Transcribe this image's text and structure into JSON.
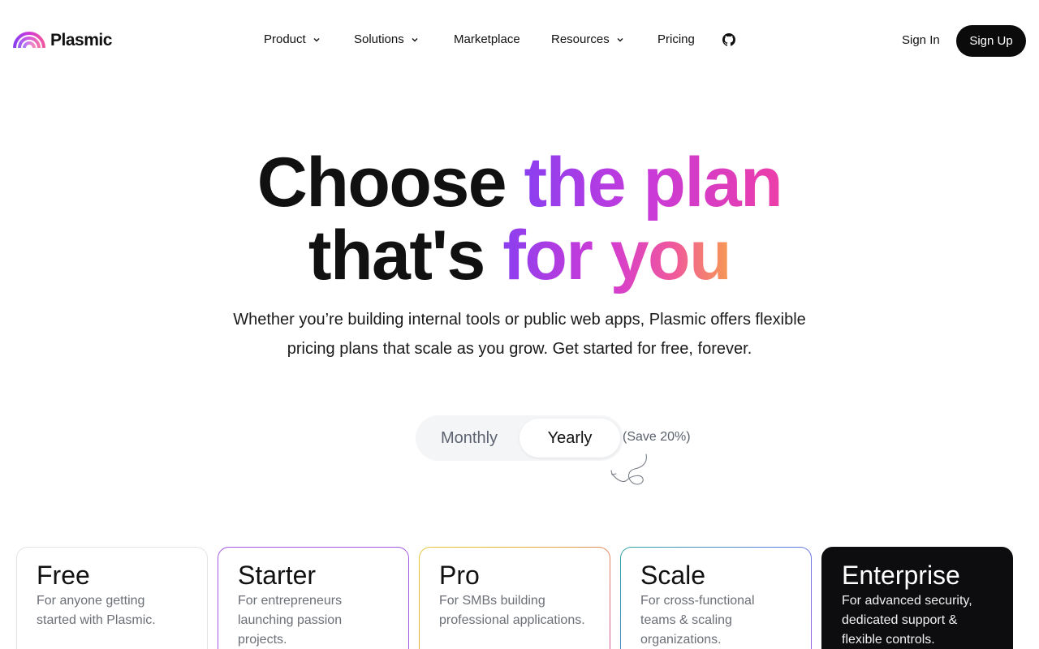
{
  "brand": {
    "name": "Plasmic"
  },
  "nav": {
    "items": [
      {
        "label": "Product",
        "has_dropdown": true
      },
      {
        "label": "Solutions",
        "has_dropdown": true
      },
      {
        "label": "Marketplace",
        "has_dropdown": false
      },
      {
        "label": "Resources",
        "has_dropdown": true
      },
      {
        "label": "Pricing",
        "has_dropdown": false
      }
    ],
    "github_icon": "github-icon",
    "sign_in": "Sign In",
    "sign_up": "Sign Up"
  },
  "hero": {
    "line1_plain": "Choose ",
    "line1_highlight": "the plan",
    "line2_plain": "that's ",
    "line2_highlight": "for you",
    "subtitle": "Whether you’re building internal tools or public web apps, Plasmic offers flexible pricing plans that scale as you grow. Get started for free, forever."
  },
  "billing_toggle": {
    "monthly": "Monthly",
    "yearly": "Yearly",
    "selected": "Yearly",
    "save_note": "(Save 20%)"
  },
  "plans": [
    {
      "name": "Free",
      "description": "For anyone getting started with Plasmic."
    },
    {
      "name": "Starter",
      "description": "For entrepreneurs launching passion projects."
    },
    {
      "name": "Pro",
      "description": "For SMBs building professional applications."
    },
    {
      "name": "Scale",
      "description": "For cross-functional teams & scaling organizations."
    },
    {
      "name": "Enterprise",
      "description": "For advanced security, dedicated support & flexible controls."
    }
  ],
  "colors": {
    "primary_button": "#0b0b0c",
    "gradient_purple": "#8b3ff0",
    "gradient_pink": "#ec3fa8",
    "gradient_orange": "#f79a52",
    "starter_border": "#a25ae6",
    "enterprise_bg": "#0d0d0f"
  }
}
